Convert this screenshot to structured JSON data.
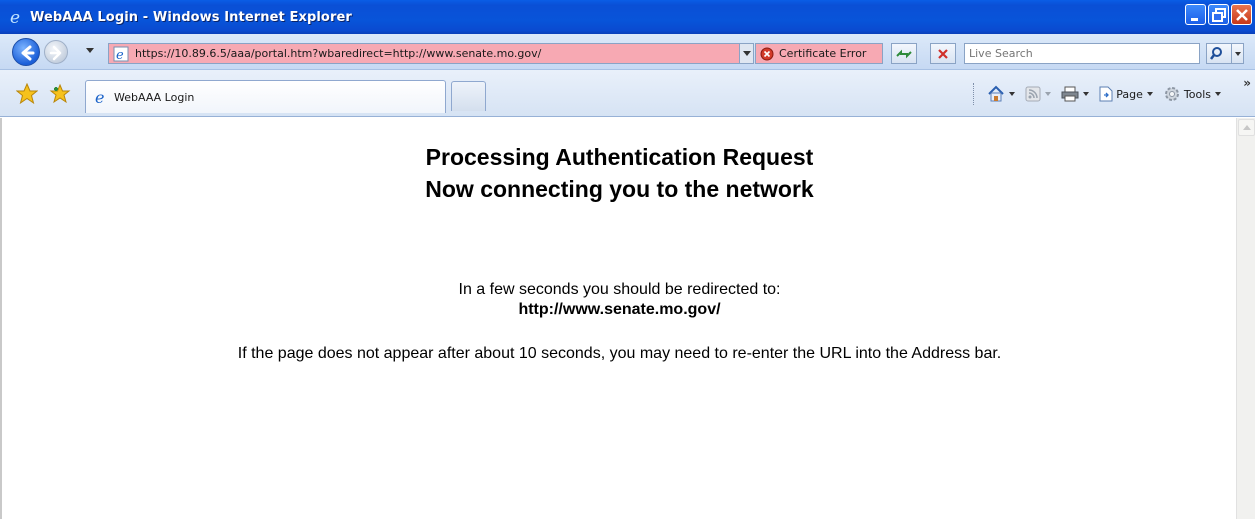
{
  "window": {
    "title": "WebAAA Login - Windows Internet Explorer"
  },
  "address_bar": {
    "url": "https://10.89.6.5/aaa/portal.htm?wbaredirect=http://www.senate.mo.gov/",
    "certificate_error": "Certificate Error",
    "search_placeholder": "Live Search"
  },
  "tabs": [
    {
      "label": "WebAAA Login"
    }
  ],
  "command_bar": {
    "page_label": "Page",
    "tools_label": "Tools",
    "overflow": "»"
  },
  "page": {
    "heading_line1": "Processing Authentication Request",
    "heading_line2": "Now connecting you to the network",
    "redirect_text": "In a few seconds you should be redirected to:",
    "redirect_url": "http://www.senate.mo.gov/",
    "note": "If the page does not appear after about 10 seconds, you may need to re-enter the URL into the Address bar."
  },
  "colors": {
    "titlebar": "#0a54d9",
    "address_error_bg": "#f7a9b3",
    "chrome_bg": "#d6e3f4"
  },
  "icons": [
    "ie-icon",
    "minimize-icon",
    "maximize-icon",
    "close-icon",
    "back-icon",
    "forward-icon",
    "shield-error-icon",
    "refresh-icon",
    "stop-icon",
    "search-icon",
    "favorites-star-icon",
    "add-favorites-icon",
    "home-icon",
    "feeds-icon",
    "print-icon",
    "page-icon",
    "tools-gear-icon"
  ]
}
